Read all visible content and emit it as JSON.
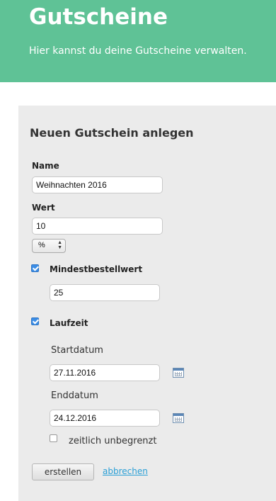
{
  "header": {
    "title": "Gutscheine",
    "subtitle": "Hier kannst du deine Gutscheine verwalten."
  },
  "form": {
    "title": "Neuen Gutschein anlegen",
    "name_label": "Name",
    "name_value": "Weihnachten 2016",
    "wert_label": "Wert",
    "wert_value": "10",
    "unit_select": "%",
    "mindestbestellwert_label": "Mindestbestellwert",
    "mindestbestellwert_checked": true,
    "mindestbestellwert_value": "25",
    "laufzeit_label": "Laufzeit",
    "laufzeit_checked": true,
    "startdatum_label": "Startdatum",
    "startdatum_value": "27.11.2016",
    "enddatum_label": "Enddatum",
    "enddatum_value": "24.12.2016",
    "unbegrenzt_label": "zeitlich unbegrenzt",
    "unbegrenzt_checked": false,
    "submit_label": "erstellen",
    "cancel_label": "abbrechen"
  },
  "colors": {
    "header_bg": "#5fc296",
    "panel_bg": "#ebebeb",
    "link": "#2a9fd6",
    "checkbox": "#3b8de6"
  },
  "icons": {
    "calendar": "calendar-icon",
    "select_arrows": "chevron-up-down-icon"
  }
}
